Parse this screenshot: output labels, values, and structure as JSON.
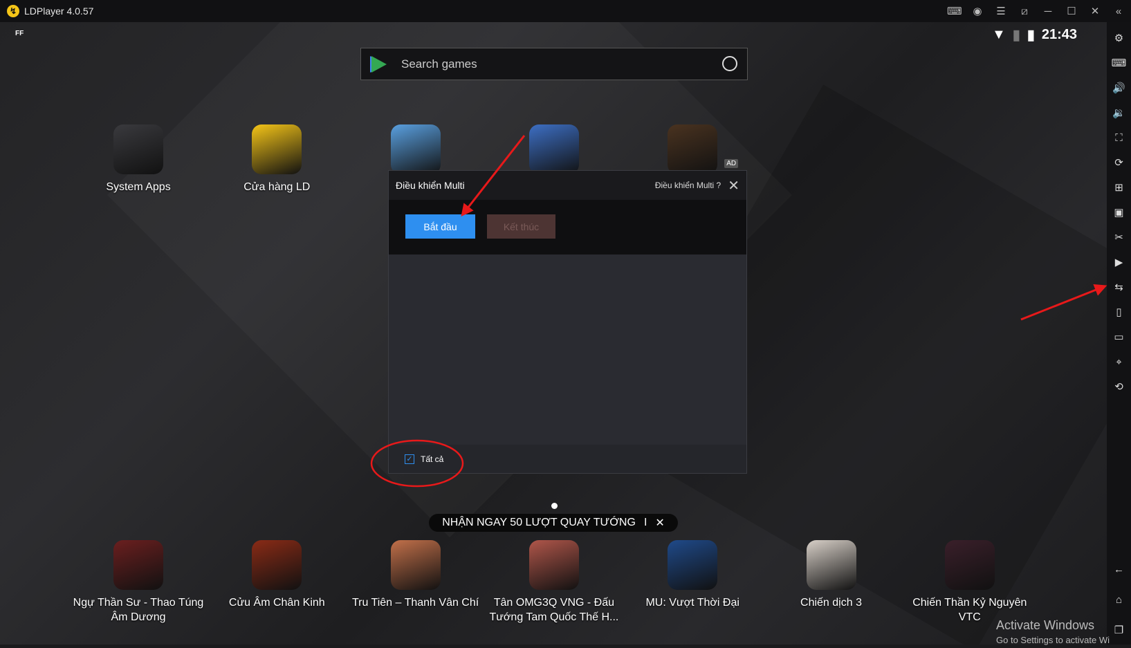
{
  "window": {
    "title": "LDPlayer 4.0.57",
    "controls": [
      "gamepad-icon",
      "account-icon",
      "menu-icon",
      "pin-icon",
      "minimize-icon",
      "maximize-icon",
      "close-icon",
      "collapse-icon"
    ]
  },
  "status": {
    "indicator": "FF",
    "time": "21:43"
  },
  "search": {
    "placeholder": "Search games"
  },
  "top_apps": [
    {
      "label": "System Apps",
      "color": "#3a3a3e"
    },
    {
      "label": "Cửa hàng LD",
      "color": "#f5c518"
    },
    {
      "label": "",
      "color": "#5aa0e0"
    },
    {
      "label": "",
      "color": "#3d6fc4"
    },
    {
      "label": "",
      "color": "#4a3320",
      "badge": "AD"
    }
  ],
  "dialog": {
    "title": "Điều khiển Multi",
    "help": "Điều khiển Multi ?",
    "start": "Bắt đầu",
    "stop": "Kết thúc",
    "select_all": "Tất cả",
    "select_all_checked": true,
    "accent": "#2e8ff0"
  },
  "promo": {
    "text": "NHẬN NGAY 50 LƯỢT QUAY TƯỚNG",
    "separator": "I",
    "close": "✕"
  },
  "bottom_apps": [
    {
      "label": "Ngự Thần Sư - Thao Túng Âm Dương",
      "color": "#6b1f1f"
    },
    {
      "label": "Cửu Âm Chân Kinh",
      "color": "#8a2b16"
    },
    {
      "label": "Tru Tiên – Thanh Vân Chí",
      "color": "#c2704a"
    },
    {
      "label": "Tân OMG3Q VNG - Đấu Tướng Tam Quốc Thế H...",
      "color": "#b0564a"
    },
    {
      "label": "MU: Vượt Thời Đại",
      "color": "#1f4a8a"
    },
    {
      "label": "Chiến dịch 3",
      "color": "#d8d0c8"
    },
    {
      "label": "Chiến Thần Kỷ Nguyên VTC",
      "color": "#3a1f2a"
    }
  ],
  "sidebar": [
    "settings-icon",
    "keyboard-icon",
    "volume-up-icon",
    "volume-down-icon",
    "fullscreen-icon",
    "sync-icon",
    "add-screen-icon",
    "apk-icon",
    "scissors-icon",
    "record-icon",
    "multi-sync-icon",
    "shake-icon",
    "folder-icon",
    "location-icon",
    "rotate-icon",
    "back-icon",
    "home-icon",
    "recents-icon"
  ],
  "watermark": {
    "line1": "Activate Windows",
    "line2": "Go to Settings to activate Wi"
  }
}
